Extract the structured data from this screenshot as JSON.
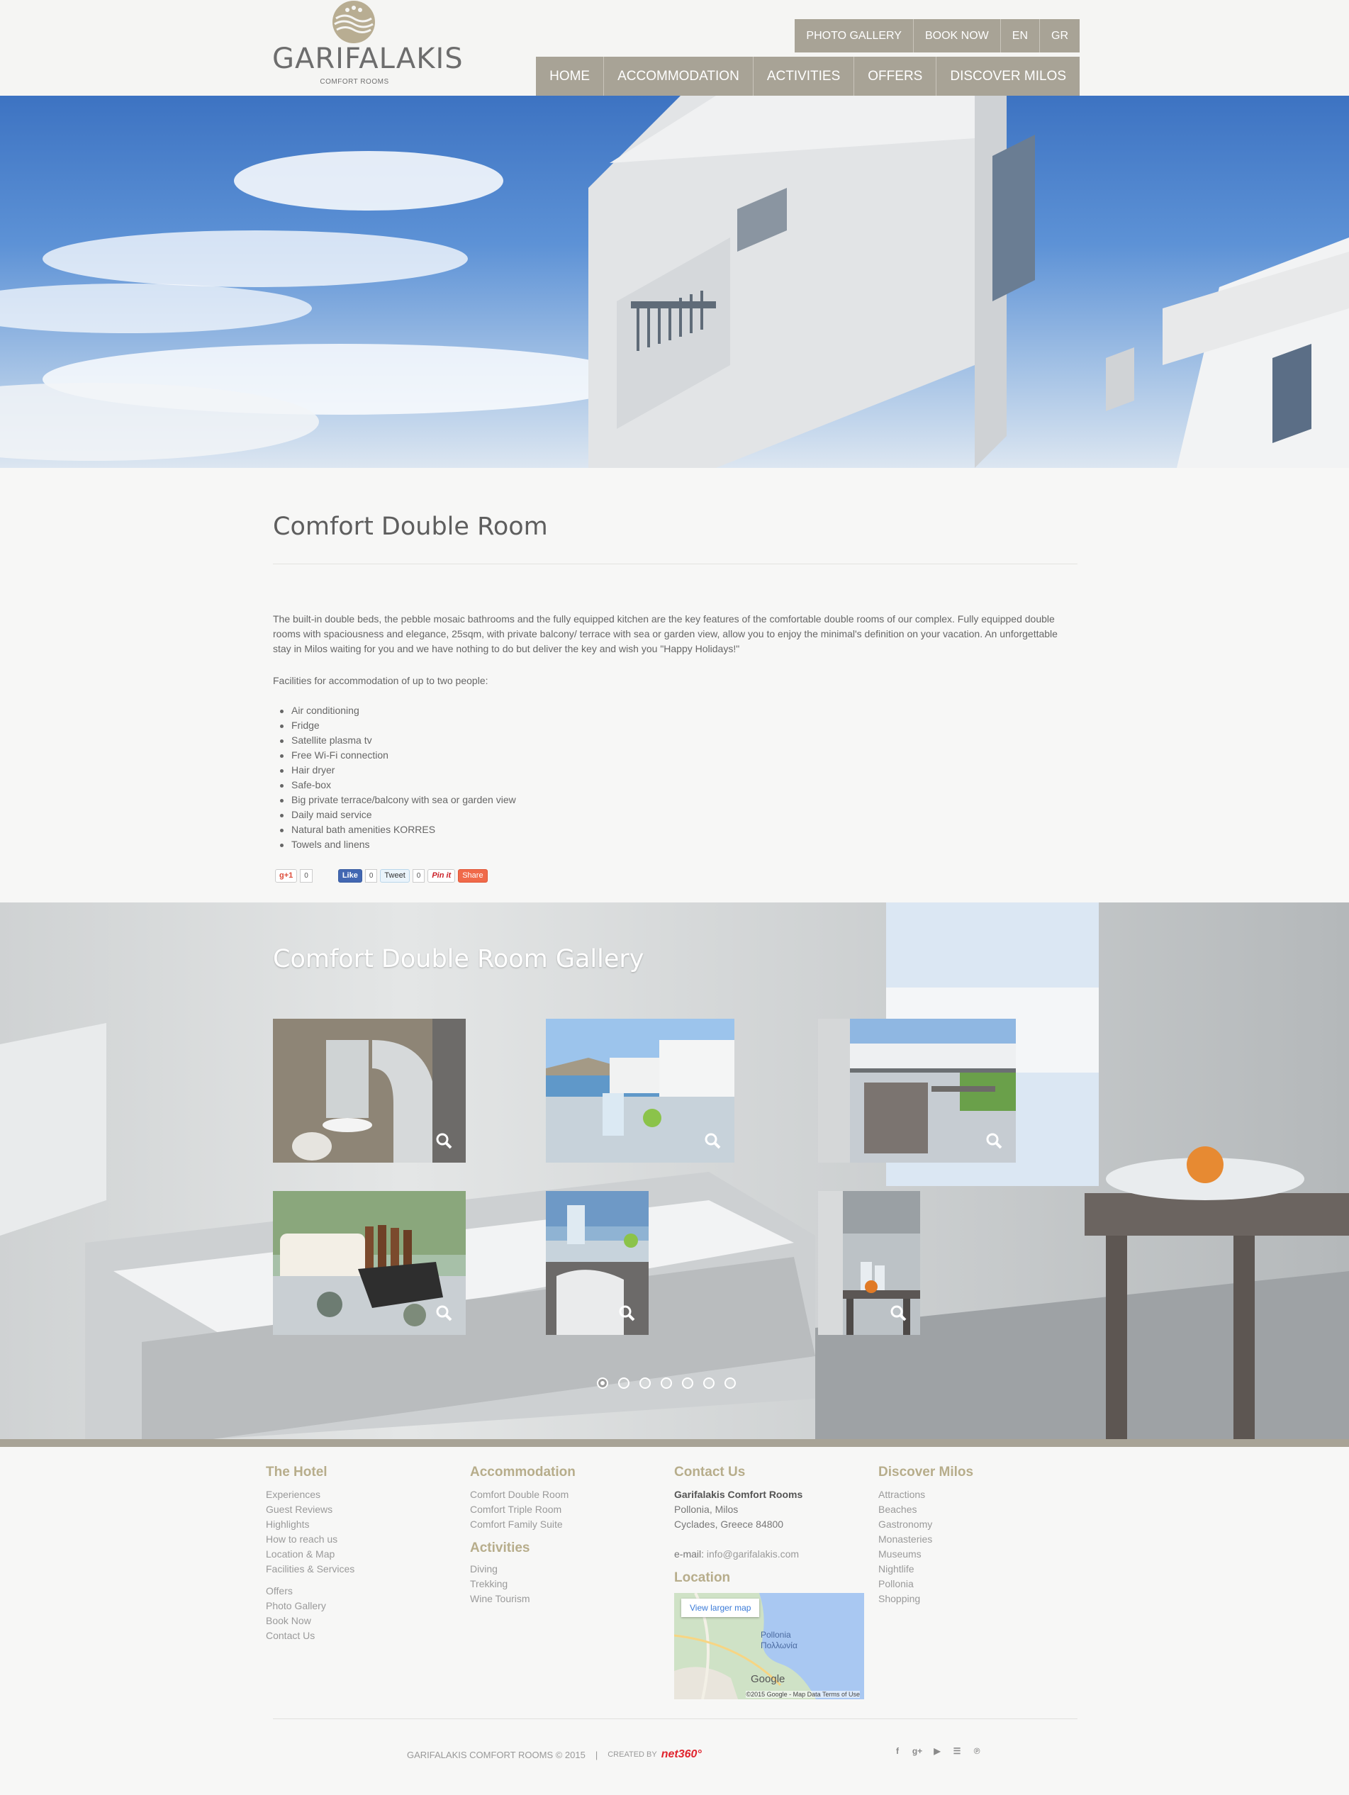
{
  "header": {
    "logo_name": "GARIFALAKIS",
    "logo_sub": "COMFORT ROOMS",
    "topbar": [
      "PHOTO GALLERY",
      "BOOK NOW",
      "EN",
      "GR"
    ],
    "nav": [
      "HOME",
      "ACCOMMODATION",
      "ACTIVITIES",
      "OFFERS",
      "DISCOVER MILOS"
    ]
  },
  "room": {
    "title": "Comfort Double Room",
    "description": "The built-in double beds, the pebble mosaic bathrooms and the fully equipped kitchen are the key features of the comfortable double rooms of our complex. Fully equipped double rooms with spaciousness and elegance, 25sqm, with private balcony/ terrace with sea or garden view, allow you to enjoy the minimal's definition on your vacation. An unforgettable stay in Milos waiting for you and we have nothing to do but deliver the key and wish you \"Happy Holidays!\"",
    "facilities_intro": "Facilities for accommodation of up to two people:",
    "facilities": [
      "Air conditioning",
      "Fridge",
      "Satellite plasma tv",
      "Free Wi-Fi connection",
      "Hair dryer",
      "Safe-box",
      "Big private terrace/balcony with sea or garden view",
      "Daily maid service",
      "Natural bath amenities KORRES",
      "Towels and linens"
    ]
  },
  "share": {
    "gplus": "g+1",
    "gplus_count": "0",
    "like": "Like",
    "like_count": "0",
    "tweet": "Tweet",
    "tweet_count": "0",
    "pin": "Pin it",
    "share": "Share"
  },
  "gallery": {
    "title": "Comfort Double Room Gallery",
    "thumbs": [
      "bathroom",
      "sea-view",
      "balcony",
      "amenities",
      "table-view",
      "kitchen"
    ],
    "page_count": 7,
    "active_page": 1
  },
  "footer": {
    "hotel": {
      "heading": "The Hotel",
      "links": [
        "Experiences",
        "Guest Reviews",
        "Highlights",
        "How to reach us",
        "Location & Map",
        "Facilities & Services"
      ],
      "links2": [
        "Offers",
        "Photo Gallery",
        "Book Now",
        "Contact Us"
      ]
    },
    "accommodation": {
      "heading": "Accommodation",
      "links": [
        "Comfort Double Room",
        "Comfort Triple Room",
        "Comfort Family Suite"
      ]
    },
    "activities": {
      "heading": "Activities",
      "links": [
        "Diving",
        "Trekking",
        "Wine Tourism"
      ]
    },
    "contact": {
      "heading": "Contact Us",
      "name": "Garifalakis Comfort Rooms",
      "address1": "Pollonia, Milos",
      "address2": "Cyclades, Greece 84800",
      "email_label": "e-mail:",
      "email": "info@garifalakis.com"
    },
    "location": {
      "heading": "Location",
      "map_button": "View larger map",
      "map_place": "Pollonia",
      "map_place_gr": "Πολλωνία",
      "map_brand": "Google",
      "map_credit": "©2015 Google - Map Data    Terms of Use"
    },
    "discover": {
      "heading": "Discover Milos",
      "links": [
        "Attractions",
        "Beaches",
        "Gastronomy",
        "Monasteries",
        "Museums",
        "Nightlife",
        "Pollonia",
        "Shopping"
      ]
    },
    "copyright": "GARIFALAKIS COMFORT ROOMS © 2015",
    "sep": "|",
    "created_by": "CREATED BY",
    "brand": "net360°",
    "social": [
      "facebook-icon",
      "google-plus-icon",
      "youtube-icon",
      "rss-icon",
      "pinterest-icon"
    ]
  }
}
